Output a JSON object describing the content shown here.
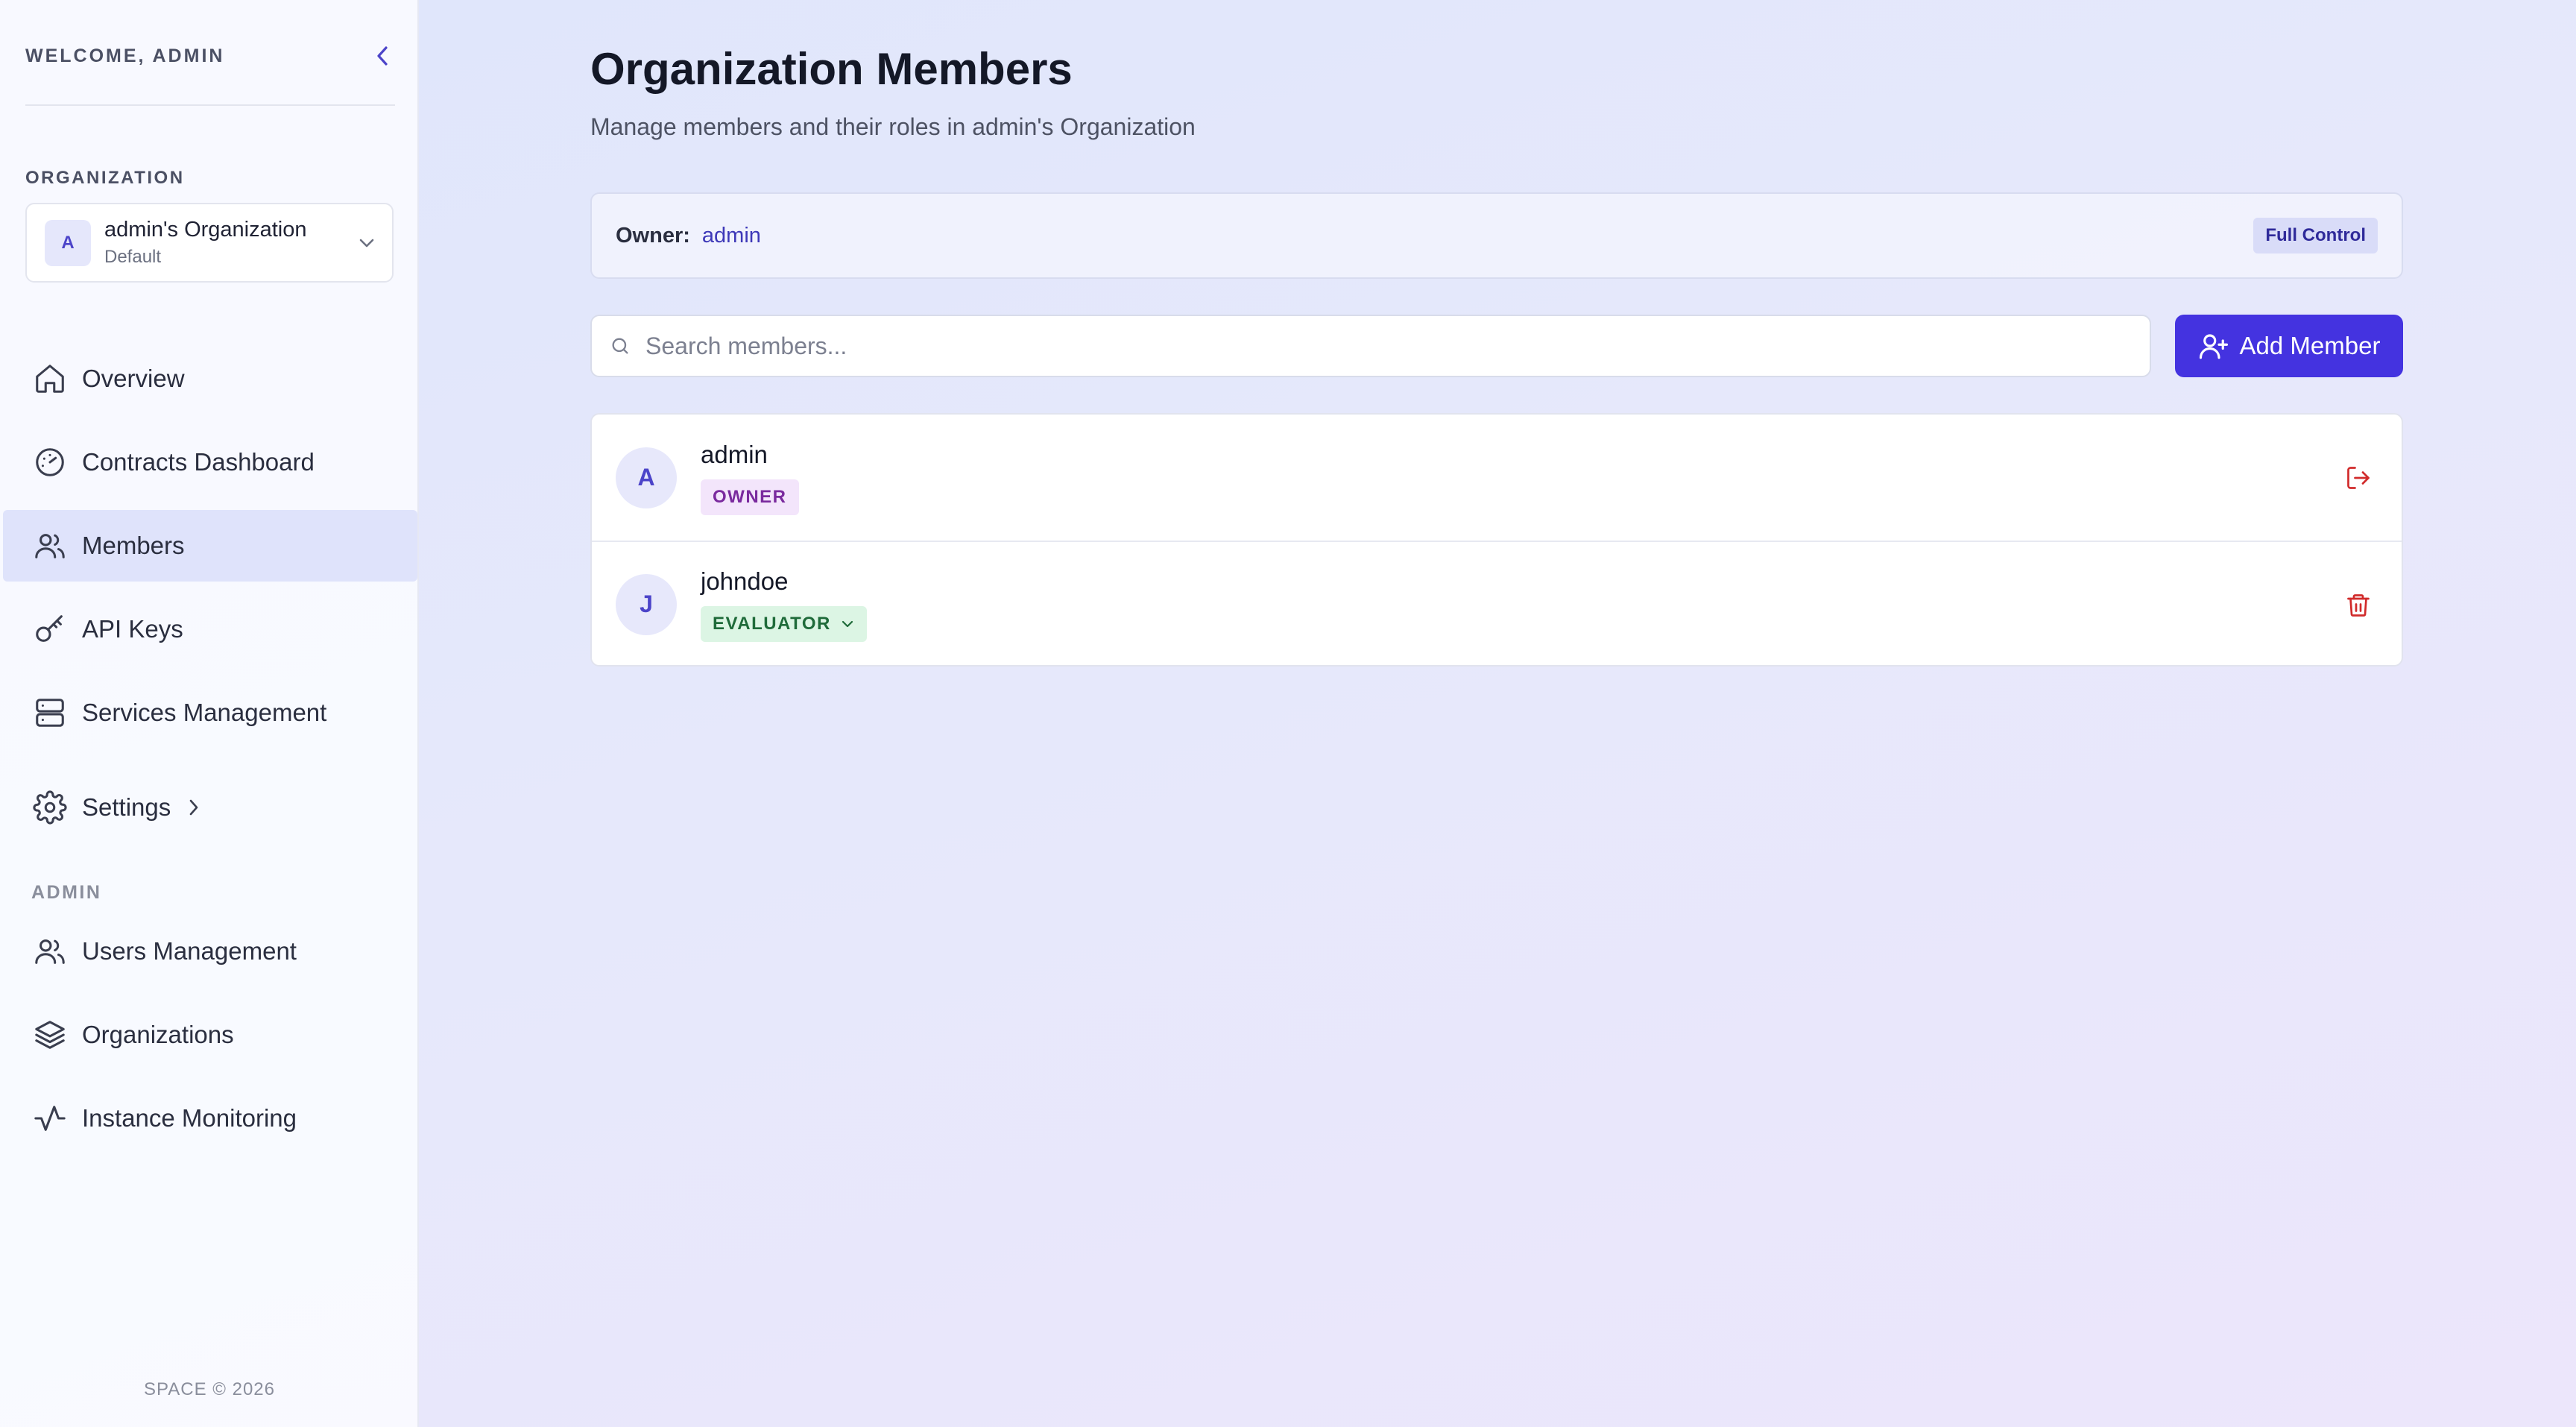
{
  "sidebar": {
    "welcome": "WELCOME, ADMIN",
    "organization_label": "ORGANIZATION",
    "org": {
      "initial": "A",
      "name": "admin's Organization",
      "sub": "Default"
    },
    "nav": [
      {
        "label": "Overview",
        "icon": "home-icon"
      },
      {
        "label": "Contracts Dashboard",
        "icon": "gauge-icon"
      },
      {
        "label": "Members",
        "icon": "users-icon",
        "active": true
      },
      {
        "label": "API Keys",
        "icon": "key-icon"
      },
      {
        "label": "Services Management",
        "icon": "server-icon"
      },
      {
        "label": "Settings",
        "icon": "gear-icon"
      }
    ],
    "admin_label": "ADMIN",
    "admin_nav": [
      {
        "label": "Users Management",
        "icon": "users-icon"
      },
      {
        "label": "Organizations",
        "icon": "layers-icon"
      },
      {
        "label": "Instance Monitoring",
        "icon": "activity-icon"
      }
    ],
    "footer": "SPACE © 2026"
  },
  "main": {
    "title": "Organization Members",
    "subtitle": "Manage members and their roles in admin's Organization",
    "owner": {
      "key": "Owner:",
      "value": "admin",
      "badge": "Full Control"
    },
    "search": {
      "placeholder": "Search members...",
      "value": ""
    },
    "add_button": "Add Member",
    "members": [
      {
        "initial": "A",
        "name": "admin",
        "role": "OWNER",
        "action": "leave-icon"
      },
      {
        "initial": "J",
        "name": "johndoe",
        "role": "EVALUATOR",
        "action": "trash-icon"
      }
    ]
  },
  "colors": {
    "accent": "#4433e0",
    "active_nav_bg": "#dfe3fb",
    "owner_badge_bg": "#f3e5fb",
    "evaluator_badge_bg": "#dcf5e4",
    "danger": "#d12b2b"
  }
}
